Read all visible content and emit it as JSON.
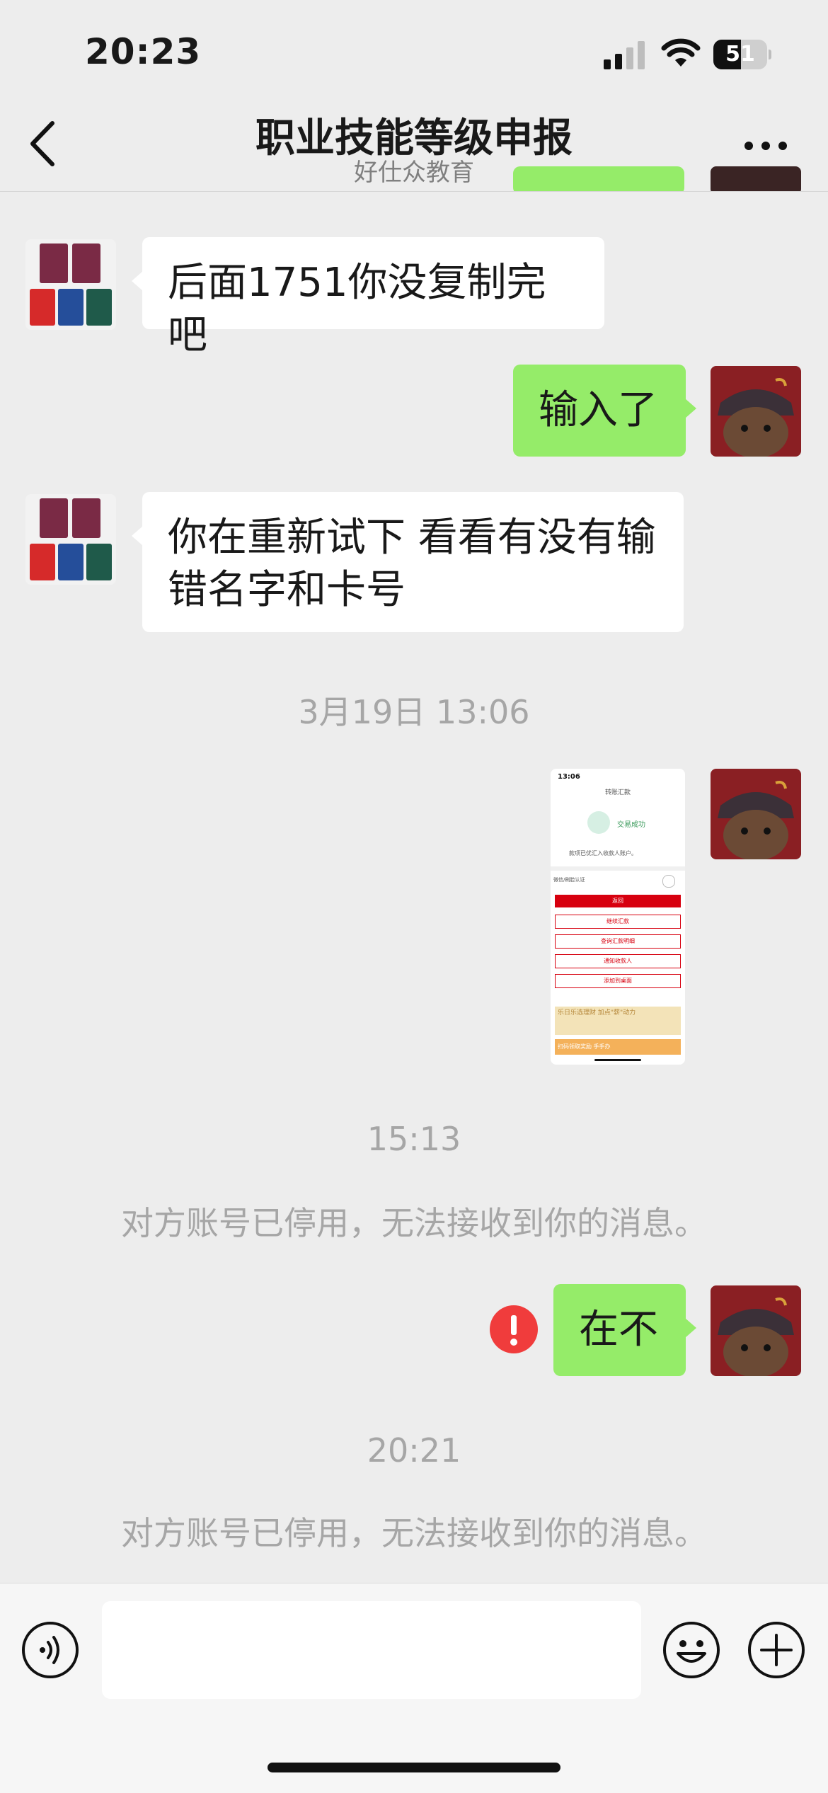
{
  "status": {
    "time": "20:23",
    "battery": "51",
    "battery_level": 0.51
  },
  "header": {
    "title": "职业技能等级申报",
    "subtitle": "好仕众教育"
  },
  "messages": {
    "m1": "后面1751你没复制完吧",
    "m2": "输入了",
    "m3": "你在重新试下 看看有没有输错名字和卡号",
    "ts1": "3月19日 13:06",
    "ts2": "15:13",
    "sys1": "对方账号已停用，无法接收到你的消息。",
    "m4": "在不",
    "ts3": "20:21",
    "sys2": "对方账号已停用，无法接收到你的消息。"
  },
  "screenshot": {
    "time": "13:06",
    "title": "转账汇款",
    "success": "交易成功",
    "desc": "款项已优汇入收款人账户。",
    "toggle_label": "微信/刷脸认证",
    "buttons": [
      "返回",
      "继续汇款",
      "查询汇款明细",
      "通知收款人",
      "添加到桌面"
    ],
    "banner1": "乐日乐选理财 加点\"薪\"动力",
    "banner2": "扫码领取奖励 手手办"
  },
  "colors": {
    "bubble_out": "#95ec69",
    "bubble_in": "#ffffff",
    "error": "#f03c3c"
  },
  "icons": [
    "signal-icon",
    "wifi-icon",
    "battery-icon",
    "back-icon",
    "more-icon",
    "error-icon",
    "voice-icon",
    "emoji-icon",
    "plus-icon"
  ]
}
